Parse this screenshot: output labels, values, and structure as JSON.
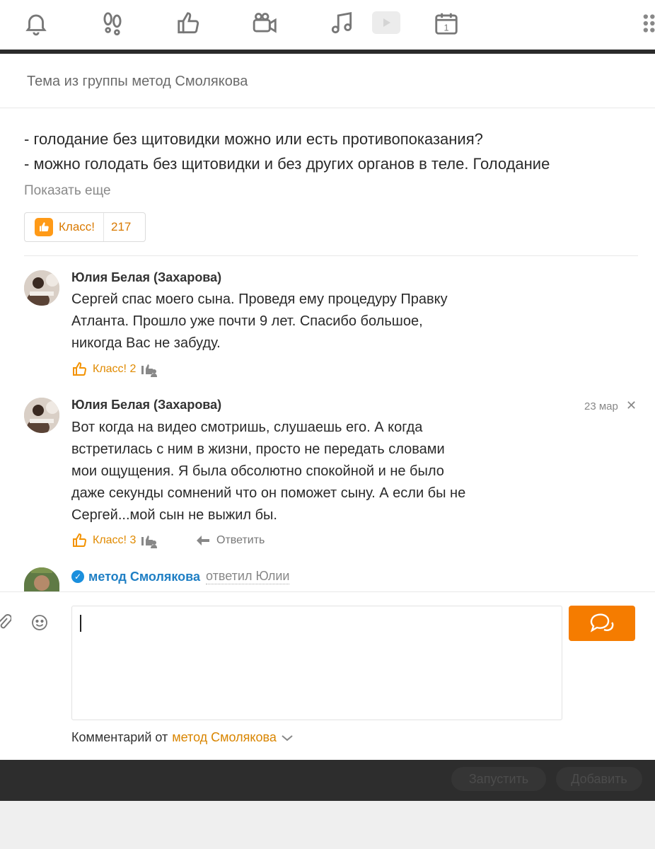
{
  "topbar": {
    "icons": [
      "bell-icon",
      "footprints-icon",
      "thumbs-up-icon",
      "video-camera-icon",
      "music-note-icon",
      "play-icon",
      "calendar-icon",
      "grid-dots-icon"
    ],
    "calendar_day": "1"
  },
  "topic": {
    "title": "Тема из группы метод Смолякова"
  },
  "post": {
    "lines": [
      "- голодание без щитовидки можно или есть противопоказания?",
      "- можно голодать без щитовидки и без других органов в теле. Голодание"
    ],
    "show_more": "Показать еще",
    "klass_label": "Класс!",
    "klass_count": "217"
  },
  "comments": [
    {
      "author": "Юлия Белая (Захарова)",
      "lines": [
        "Сергей спас моего сына. Проведя ему процедуру Правку",
        "Атланта. Прошло уже почти 9 лет. Спасибо большое,",
        "никогда Вас не забуду."
      ],
      "klass": "Класс! 2"
    },
    {
      "author": "Юлия Белая (Захарова)",
      "date": "23 мар",
      "lines": [
        "Вот когда на видео смотришь, слушаешь его. А когда",
        "встретилась с ним в жизни, просто не передать словами",
        "мои ощущения. Я была обсолютно спокойной и не было",
        "даже секунды сомнений что он поможет сыну. А если бы не",
        "Сергей...мой сын не выжил бы."
      ],
      "klass": "Класс! 3",
      "reply_label": "Ответить"
    }
  ],
  "reply": {
    "author": "метод Смолякова",
    "to": "ответил Юлии"
  },
  "composer": {
    "comment_from_label": "Комментарий от",
    "comment_from_group": "метод Смолякова"
  },
  "bottom": {
    "run_label": "Запустить",
    "add_label": "Добавить"
  },
  "colors": {
    "accent": "#f57c00",
    "klass_text": "#d97900",
    "link_blue": "#1f7fc4"
  }
}
